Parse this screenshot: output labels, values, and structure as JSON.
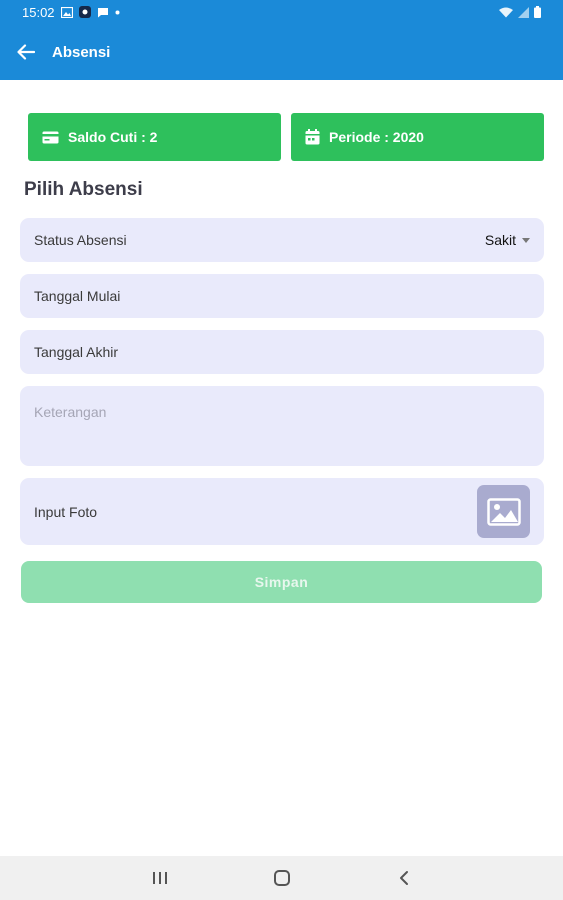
{
  "status_bar": {
    "time": "15:02",
    "icons_left": [
      "image-icon",
      "app-badge-icon",
      "message-icon",
      "dot-icon"
    ],
    "icons_right": [
      "wifi-icon",
      "signal-icon",
      "battery-icon"
    ]
  },
  "app_bar": {
    "title": "Absensi",
    "back_icon": "arrow-left-icon",
    "color": "#1b8ad8"
  },
  "cards": {
    "saldo_label": "Saldo Cuti : 2",
    "periode_label": "Periode : 2020",
    "color": "#2ec05c"
  },
  "form": {
    "section_title": "Pilih Absensi",
    "status_label": "Status Absensi",
    "status_value": "Sakit",
    "start_label": "Tanggal Mulai",
    "end_label": "Tanggal Akhir",
    "note_placeholder": "Keterangan",
    "photo_label": "Input Foto",
    "save_label": "Simpan",
    "save_color": "#8fdfb0"
  },
  "nav_bar": {
    "buttons": [
      "recents-icon",
      "home-icon",
      "back-icon"
    ]
  }
}
